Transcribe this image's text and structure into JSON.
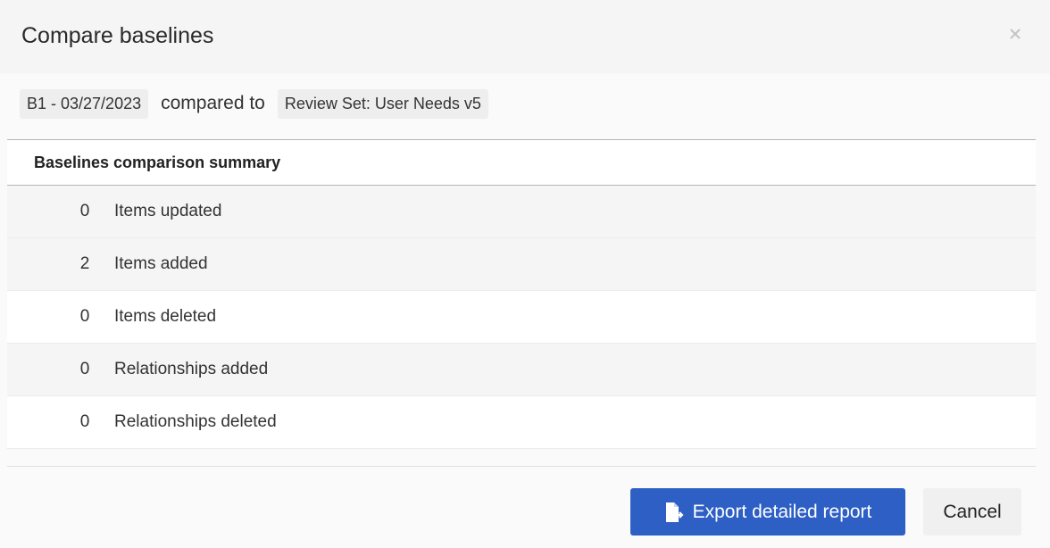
{
  "dialog": {
    "title": "Compare baselines",
    "close_icon": "close-icon"
  },
  "comparison": {
    "baseline_left": "B1 - 03/27/2023",
    "connector": "compared to",
    "baseline_right": "Review Set: User Needs v5"
  },
  "summary": {
    "title": "Baselines comparison summary",
    "rows": [
      {
        "count": "0",
        "label": "Items updated"
      },
      {
        "count": "2",
        "label": "Items added"
      },
      {
        "count": "0",
        "label": "Items deleted"
      },
      {
        "count": "0",
        "label": "Relationships added"
      },
      {
        "count": "0",
        "label": "Relationships deleted"
      }
    ]
  },
  "actions": {
    "export_label": "Export detailed report",
    "export_icon": "export-file-icon",
    "cancel_label": "Cancel"
  },
  "colors": {
    "primary_button": "#2d5fc4",
    "header_bg": "#f5f5f5"
  }
}
